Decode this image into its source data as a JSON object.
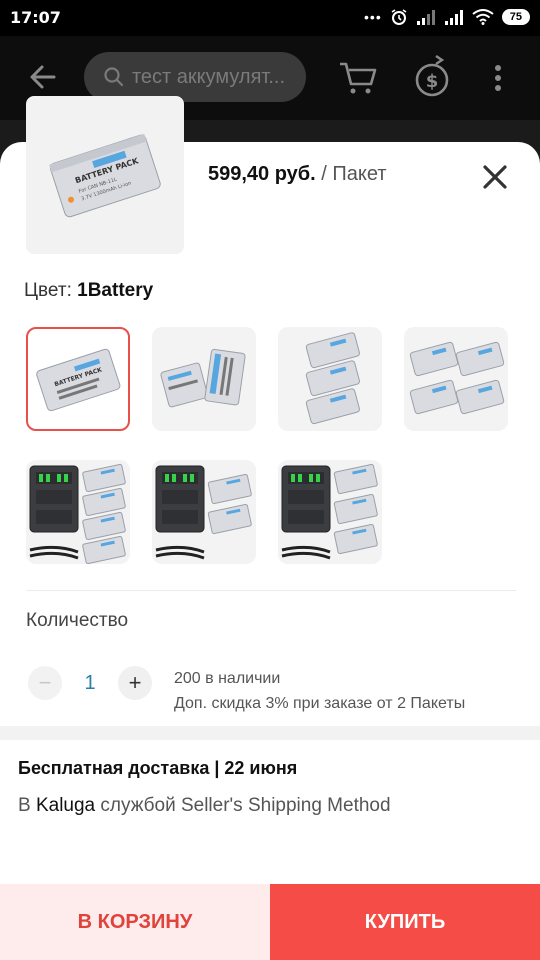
{
  "status_bar": {
    "time": "17:07",
    "dots": "•••",
    "battery": "75"
  },
  "app_bar": {
    "search_placeholder": "тест аккумулят..."
  },
  "product": {
    "price": "599,40 руб.",
    "unit": " / Пакет"
  },
  "color": {
    "label": "Цвет: ",
    "value": "1Battery"
  },
  "variants": [
    {
      "kind": "battery-single",
      "selected": true
    },
    {
      "kind": "battery-pair",
      "selected": false
    },
    {
      "kind": "battery-three",
      "selected": false
    },
    {
      "kind": "battery-four",
      "selected": false
    },
    {
      "kind": "charger-four",
      "selected": false
    },
    {
      "kind": "charger-two",
      "selected": false
    },
    {
      "kind": "charger-three",
      "selected": false
    }
  ],
  "quantity": {
    "title": "Количество",
    "minus": "−",
    "value": "1",
    "plus": "+",
    "stock": "200 в наличии",
    "discount": "Доп. скидка 3% при заказе от 2 Пакеты"
  },
  "shipping": {
    "title": "Бесплатная доставка | 22 июня",
    "prefix": "В ",
    "city": "Kaluga",
    "suffix": " службой Seller's Shipping Method"
  },
  "actions": {
    "add_to_cart": "В КОРЗИНУ",
    "buy": "КУПИТЬ"
  },
  "colors": {
    "accent": "#f64c47",
    "accent_light": "#fdeceb",
    "selected_border": "#e8504a",
    "qty_value": "#2a7fa8"
  }
}
